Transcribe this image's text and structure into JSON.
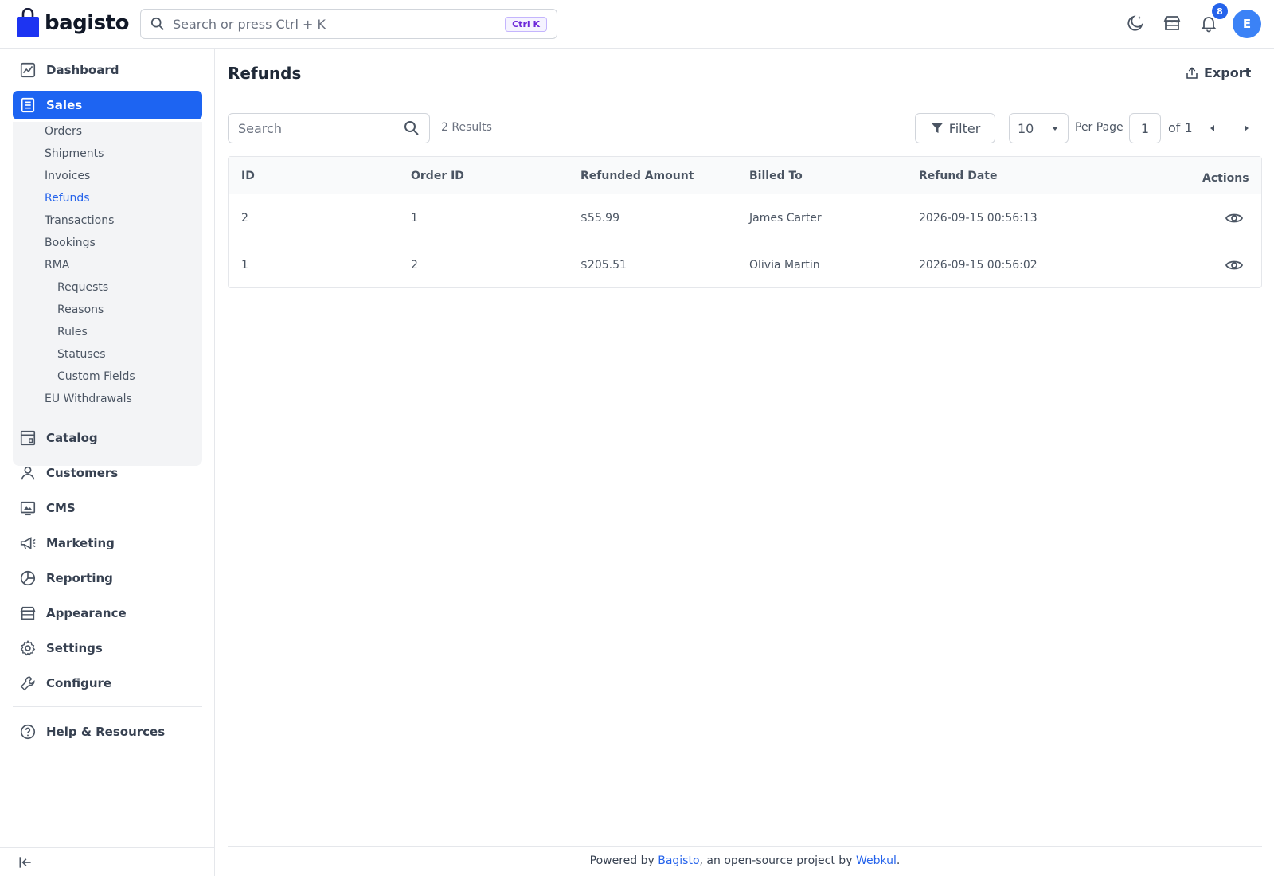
{
  "header": {
    "brand": "bagisto",
    "search_placeholder": "Search or press Ctrl + K",
    "shortcut": "Ctrl K",
    "notification_count": "8",
    "avatar_initial": "E",
    "icons": [
      "moon-icon",
      "store-icon",
      "bell-icon"
    ]
  },
  "sidebar": {
    "items": [
      {
        "label": "Dashboard",
        "icon": "dashboard-icon"
      },
      {
        "label": "Sales",
        "icon": "sales-icon",
        "active": true
      },
      {
        "label": "Catalog",
        "icon": "catalog-icon"
      },
      {
        "label": "Customers",
        "icon": "customer-icon"
      },
      {
        "label": "CMS",
        "icon": "cms-icon"
      },
      {
        "label": "Marketing",
        "icon": "megaphone-icon"
      },
      {
        "label": "Reporting",
        "icon": "pie-icon"
      },
      {
        "label": "Appearance",
        "icon": "store-front-icon"
      },
      {
        "label": "Settings",
        "icon": "gear-icon"
      },
      {
        "label": "Configure",
        "icon": "wrench-icon"
      },
      {
        "label": "Help & Resources",
        "icon": "help-icon"
      }
    ],
    "sales_sub": [
      "Orders",
      "Shipments",
      "Invoices",
      "Refunds",
      "Transactions",
      "Bookings",
      "RMA",
      "EU Withdrawals"
    ],
    "rma_sub": [
      "Requests",
      "Reasons",
      "Rules",
      "Statuses",
      "Custom Fields"
    ]
  },
  "main": {
    "title": "Refunds",
    "export_label": "Export",
    "search_placeholder": "Search",
    "results_text": "2 Results",
    "filter_label": "Filter",
    "per_page_value": "10",
    "per_page_label": "Per Page",
    "page_current": "1",
    "page_total_text": "of 1"
  },
  "table": {
    "columns": [
      "ID",
      "Order ID",
      "Refunded Amount",
      "Billed To",
      "Refund Date",
      "Actions"
    ],
    "rows": [
      {
        "id": "2",
        "order_id": "1",
        "amount": "$55.99",
        "billed_to": "James Carter",
        "date": "2026-09-15 00:56:13"
      },
      {
        "id": "1",
        "order_id": "2",
        "amount": "$205.51",
        "billed_to": "Olivia Martin",
        "date": "2026-09-15 00:56:02"
      }
    ]
  },
  "footer": {
    "prefix": "Powered by ",
    "link1": "Bagisto",
    "middle": ", an open-source project by ",
    "link2": "Webkul",
    "suffix": "."
  },
  "colors": {
    "accent": "#1d64f2",
    "link": "#2563eb"
  }
}
